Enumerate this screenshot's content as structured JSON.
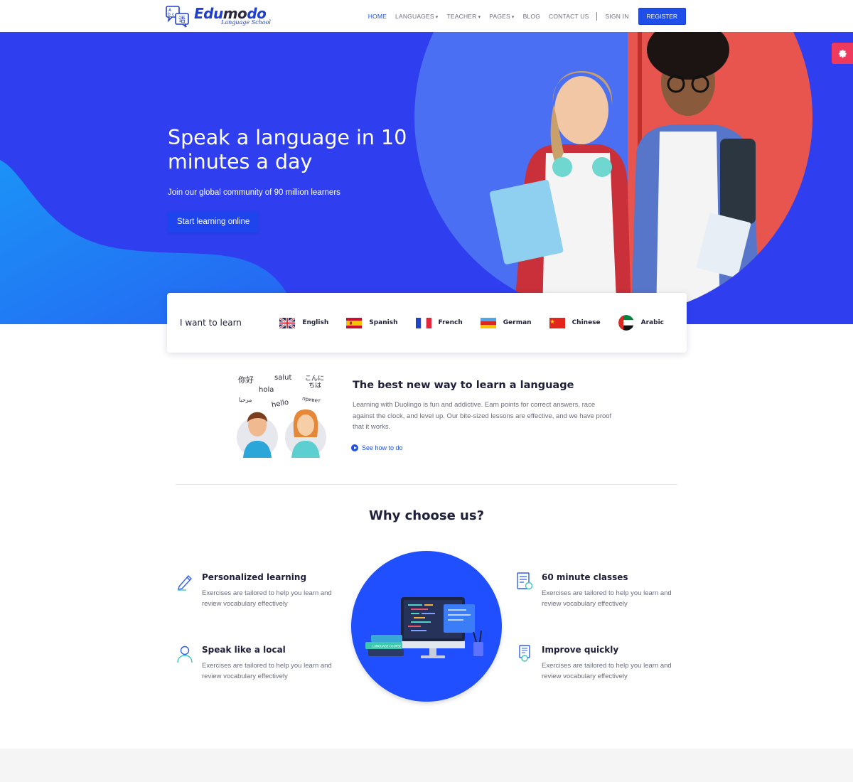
{
  "brand": {
    "name_part1": "Edu",
    "name_part2": "mo",
    "name_part3": "do",
    "tagline": "Language School",
    "logo_glyphs": [
      "A",
      "b",
      "c",
      "语"
    ]
  },
  "nav": {
    "items": [
      {
        "label": "HOME",
        "active": true,
        "dropdown": false
      },
      {
        "label": "LANGUAGES",
        "active": false,
        "dropdown": true
      },
      {
        "label": "TEACHER",
        "active": false,
        "dropdown": true
      },
      {
        "label": "PAGES",
        "active": false,
        "dropdown": true
      },
      {
        "label": "BLOG",
        "active": false,
        "dropdown": false
      },
      {
        "label": "CONTACT US",
        "active": false,
        "dropdown": false
      }
    ],
    "signin": "SIGN IN",
    "register": "REGISTER"
  },
  "hero": {
    "title": "Speak a language in 10 minutes a day",
    "subtitle": "Join our global community of 90 million learners",
    "cta": "Start learning online"
  },
  "settings_icon": "gear-icon",
  "learn_bar": {
    "label": "I want to learn",
    "languages": [
      {
        "name": "English",
        "flag": "uk-flag-icon"
      },
      {
        "name": "Spanish",
        "flag": "spain-flag-icon"
      },
      {
        "name": "French",
        "flag": "france-flag-icon"
      },
      {
        "name": "German",
        "flag": "germany-flag-icon"
      },
      {
        "name": "Chinese",
        "flag": "china-flag-icon"
      },
      {
        "name": "Arabic",
        "flag": "uae-flag-icon"
      }
    ]
  },
  "best_way": {
    "illustration_words": [
      "你好",
      "salut",
      "こんに\nちは",
      "hola",
      "مرحبا",
      "hello",
      "привет"
    ],
    "title": "The best new way to learn a language",
    "description": "Learning with Duolingo is fun and addictive. Earn points for correct answers, race against the clock, and level up. Our bite-sized lessons are effective, and we have proof that it works.",
    "link": "See how to do"
  },
  "why": {
    "title": "Why choose us?",
    "features": [
      {
        "title": "Personalized learning",
        "desc": "Exercises are tailored to help you learn and review vocabulary effectively",
        "icon": "pencil-icon"
      },
      {
        "title": "60 minute classes",
        "desc": "Exercises are tailored to help you learn and review vocabulary effectively",
        "icon": "document-icon"
      },
      {
        "title": "Speak like a local",
        "desc": "Exercises are tailored to help you learn and review vocabulary effectively",
        "icon": "user-icon"
      },
      {
        "title": "Improve quickly",
        "desc": "Exercises are tailored to help you learn and review vocabulary effectively",
        "icon": "certificate-icon"
      }
    ],
    "illustration_book_label": "LANGUAGE COURSE"
  },
  "colors": {
    "primary": "#1f4fe8",
    "hero_bg": "#2f3ff0",
    "accent_pink": "#ee3a5d",
    "heading": "#1d1f3b"
  }
}
